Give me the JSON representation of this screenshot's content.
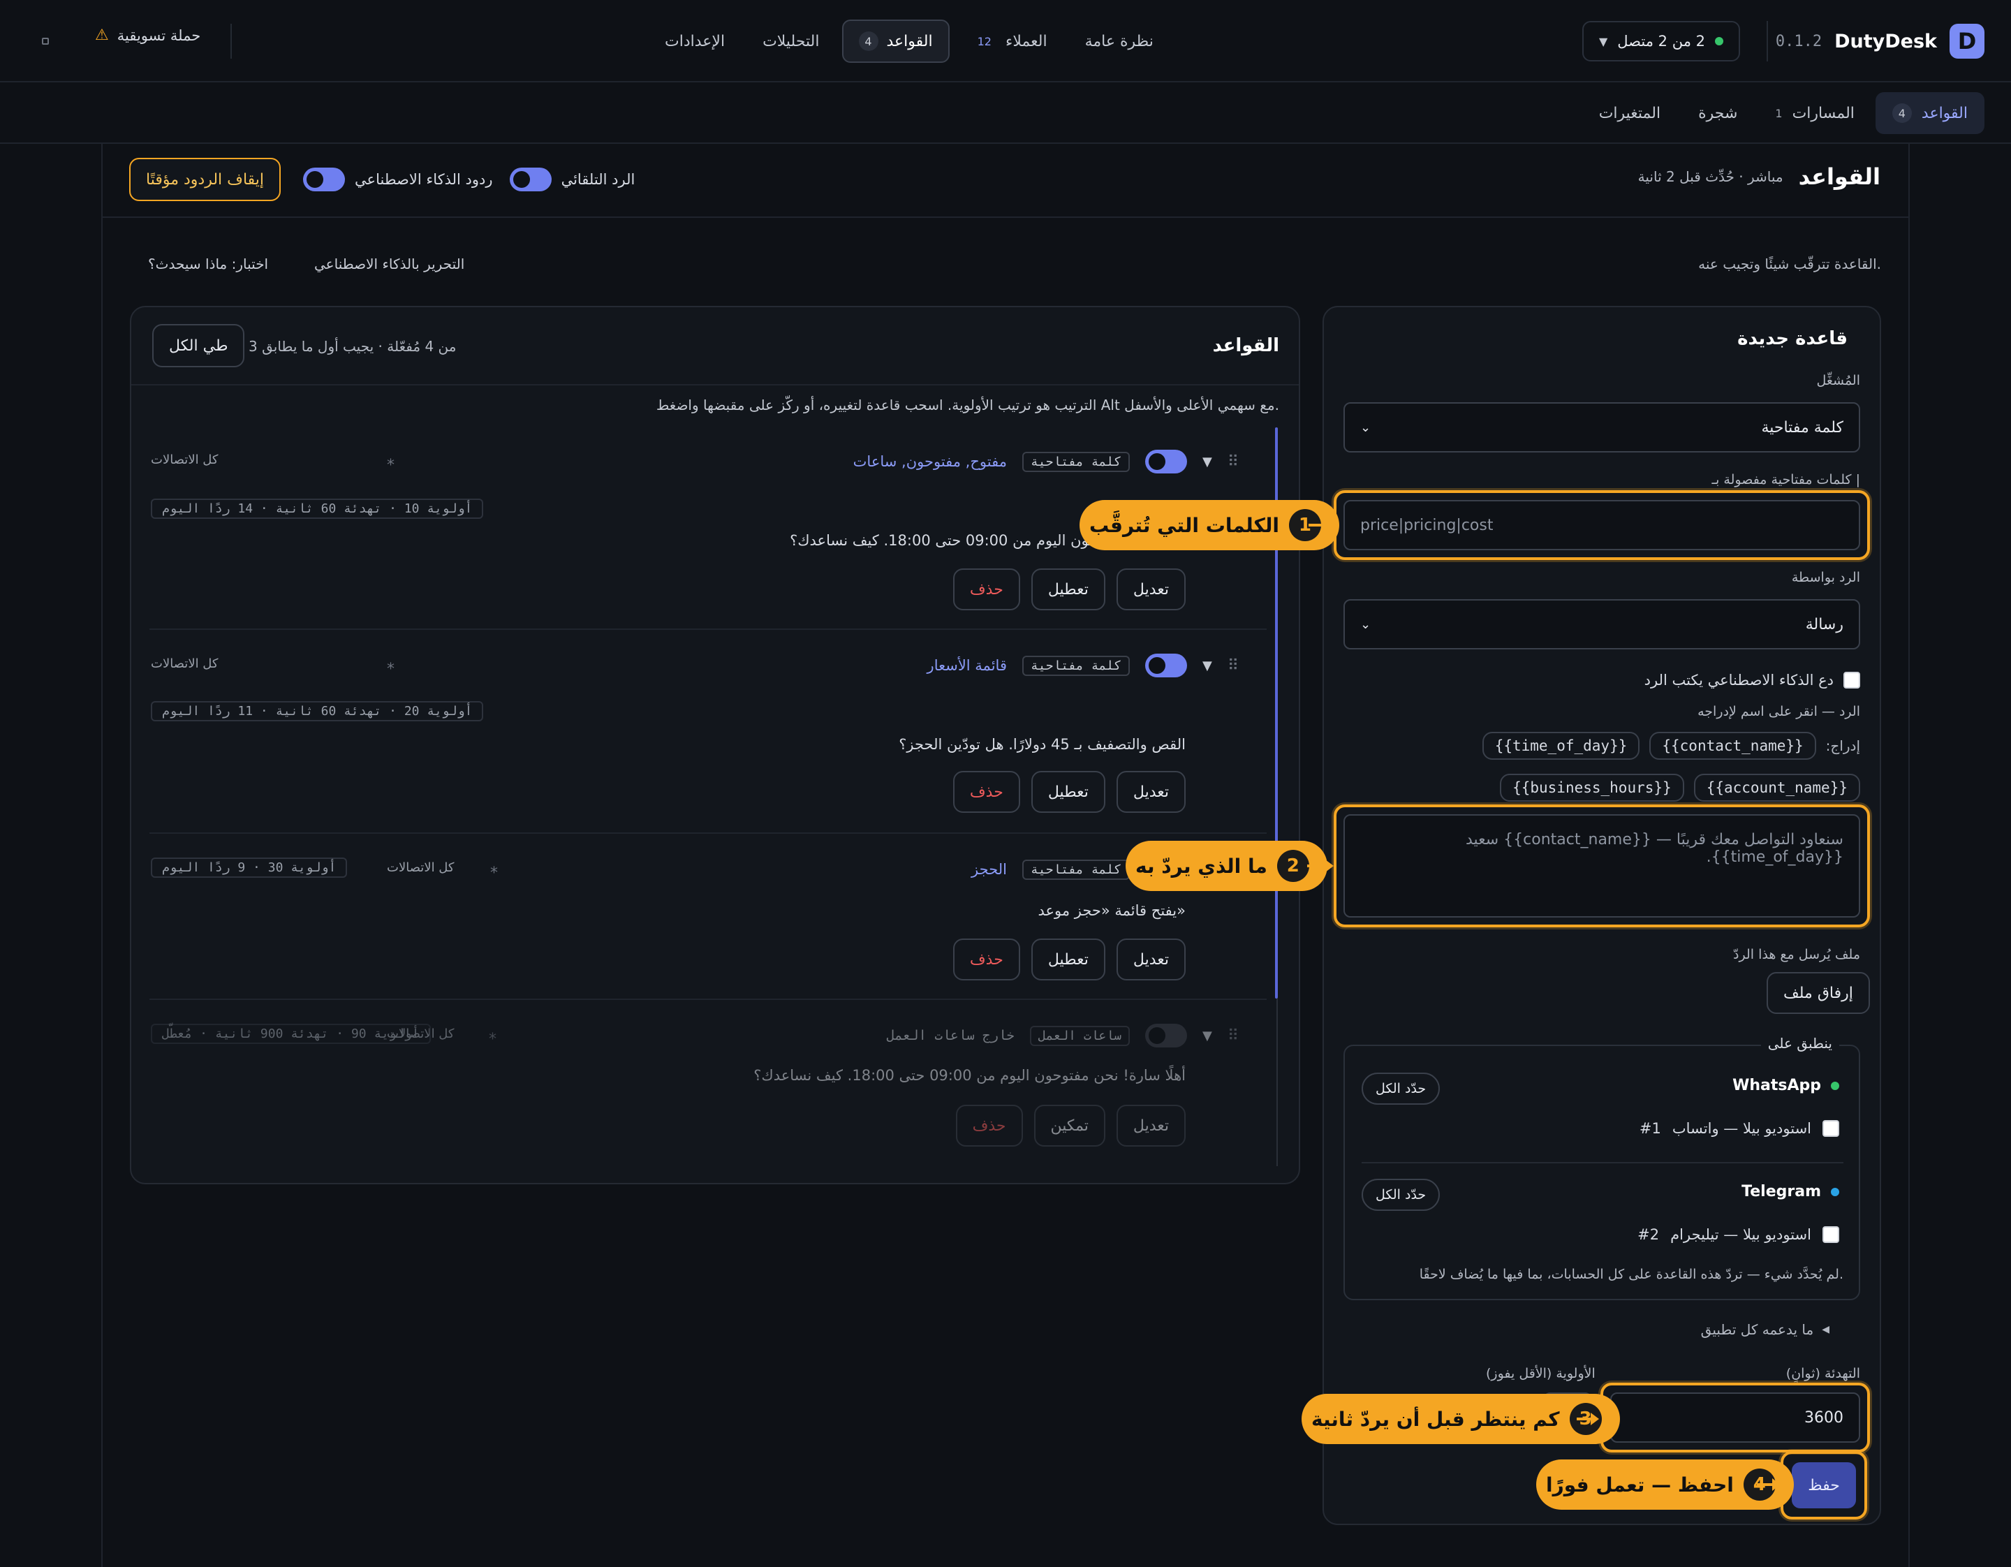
{
  "brand": {
    "name": "DutyDesk",
    "version": "0.1.2",
    "logo_letter": "D"
  },
  "connection": {
    "status": "2 من 2 متصل",
    "color": "#37c66b"
  },
  "nav": [
    {
      "label": "نظرة عامة"
    },
    {
      "label": "العملاء",
      "count": "12"
    },
    {
      "label": "القواعد",
      "count": "4",
      "active": true
    },
    {
      "label": "التحليلات"
    },
    {
      "label": "الإعدادات"
    }
  ],
  "campaign": {
    "label": "حملة تسويقية",
    "icon": "warning-icon"
  },
  "subnav": [
    {
      "label": "القواعد",
      "count": "4",
      "active": true
    },
    {
      "label": "المسارات",
      "count": "1"
    },
    {
      "label": "شجرة"
    },
    {
      "label": "المتغيرات"
    }
  ],
  "header": {
    "title": "القواعد",
    "status": "مباشر · حُدِّث قبل 2 ثانية",
    "auto_reply": "الرد التلقائي",
    "ai_replies": "ردود الذكاء الاصطناعي",
    "pause": "إيقاف الردود مؤقتًا"
  },
  "intro": {
    "text": "القاعدة تترقّب شيئًا وتجيب عنه.",
    "ai_edit": "التحرير بالذكاء الاصطناعي",
    "test": "اختبار: ماذا سيحدث؟"
  },
  "rules_panel": {
    "title": "القواعد",
    "summary": "3 من 4 مُفعّلة · يجيب أول ما يطابق",
    "collapse": "طي الكل",
    "hint": "الترتيب هو ترتيب الأولوية. اسحب قاعدة لتغييره، أو ركّز على مقبضها واضغط Alt مع سهمي الأعلى والأسفل."
  },
  "rules": [
    {
      "type": "كلمة مفتاحية",
      "name": "مفتوح, مفتوحون, ساعات",
      "scope": "كل الاتصالات",
      "meta": "أولوية 10 · تهدئة 60 ثانية · 14 ردًا اليوم",
      "reply": "أهلًا! نحن مفتوحون اليوم من 09:00 حتى 18:00. كيف نساعدك؟",
      "edit": "تعديل",
      "toggle": "تعطيل",
      "delete": "حذف"
    },
    {
      "type": "كلمة مفتاحية",
      "name": "قائمة الأسعار",
      "scope": "كل الاتصالات",
      "meta": "أولوية 20 · تهدئة 60 ثانية · 11 ردًا اليوم",
      "reply": "القص والتصفيف بـ 45 دولارًا. هل تودّين الحجز؟",
      "edit": "تعديل",
      "toggle": "تعطيل",
      "delete": "حذف"
    },
    {
      "type": "كلمة مفتاحية",
      "name": "الحجز",
      "scope": "كل الاتصالات",
      "meta": "أولوية 30 · 9 ردًا اليوم",
      "reply": "يفتح قائمة «حجز موعد»",
      "edit": "تعديل",
      "toggle": "تعطيل",
      "delete": "حذف"
    },
    {
      "type": "ساعات العمل",
      "type2": "خارج ساعات العمل",
      "scope": "كل الاتصالات",
      "meta": "أولوية 90 · تهدئة 900 ثانية · مُعطّل",
      "reply": "أهلًا سارة! نحن مفتوحون اليوم من 09:00 حتى 18:00. كيف نساعدك؟",
      "edit": "تعديل",
      "toggle": "تمكين",
      "delete": "حذف"
    }
  ],
  "form": {
    "title": "قاعدة جديدة",
    "trigger_label": "المُشغِّل",
    "trigger_value": "كلمة مفتاحية",
    "keywords_label": "كلمات مفتاحية مفصولة بـ |",
    "keywords_placeholder": "price|pricing|cost",
    "reply_with_label": "الرد بواسطة",
    "reply_with_value": "رسالة",
    "ai_write": "دع الذكاء الاصطناعي يكتب الرد",
    "reply_label": "الرد — انقر على اسم لإدراجه",
    "insert_label": "إدراج:",
    "vars": [
      "{{contact_name}}",
      "{{time_of_day}}",
      "{{account_name}}",
      "{{business_hours}}"
    ],
    "reply_placeholder": "سنعاود التواصل معك قريبًا — {{contact_name}} سعيد {{time_of_day}}.",
    "file_label": "ملف يُرسل مع هذا الردّ",
    "file_button": "إرفاق ملف",
    "applies_label": "ينطبق على",
    "platforms": [
      {
        "name": "WhatsApp",
        "color": "#37c66b",
        "select_all": "حدّد الكل",
        "account": "استوديو بيلا — واتساب",
        "num": "#1"
      },
      {
        "name": "Telegram",
        "color": "#2aa3e6",
        "select_all": "حدّد الكل",
        "account": "استوديو بيلا — تيليجرام",
        "num": "#2"
      }
    ],
    "applies_note": "لم يُحدَّد شيء — تردّ هذه القاعدة على كل الحسابات، بما فيها ما يُضاف لاحقًا.",
    "support": "ما يدعمه كل تطبيق",
    "cooldown_label": "التهدئة (ثوانٍ)",
    "cooldown_value": "3600",
    "priority_label": "الأولوية (الأقل يفوز)",
    "save": "حفظ"
  },
  "callouts": [
    {
      "num": "1",
      "text": "الكلمات التي تُترقَّب"
    },
    {
      "num": "2",
      "text": "ما الذي يردّ به"
    },
    {
      "num": "3",
      "text": "كم ينتظر قبل أن يردّ ثانية"
    },
    {
      "num": "4",
      "text": "احفظ — تعمل فورًا"
    }
  ],
  "colors": {
    "accent": "#7b8cf5",
    "highlight": "#f5a623",
    "danger": "#ef5b5b"
  }
}
